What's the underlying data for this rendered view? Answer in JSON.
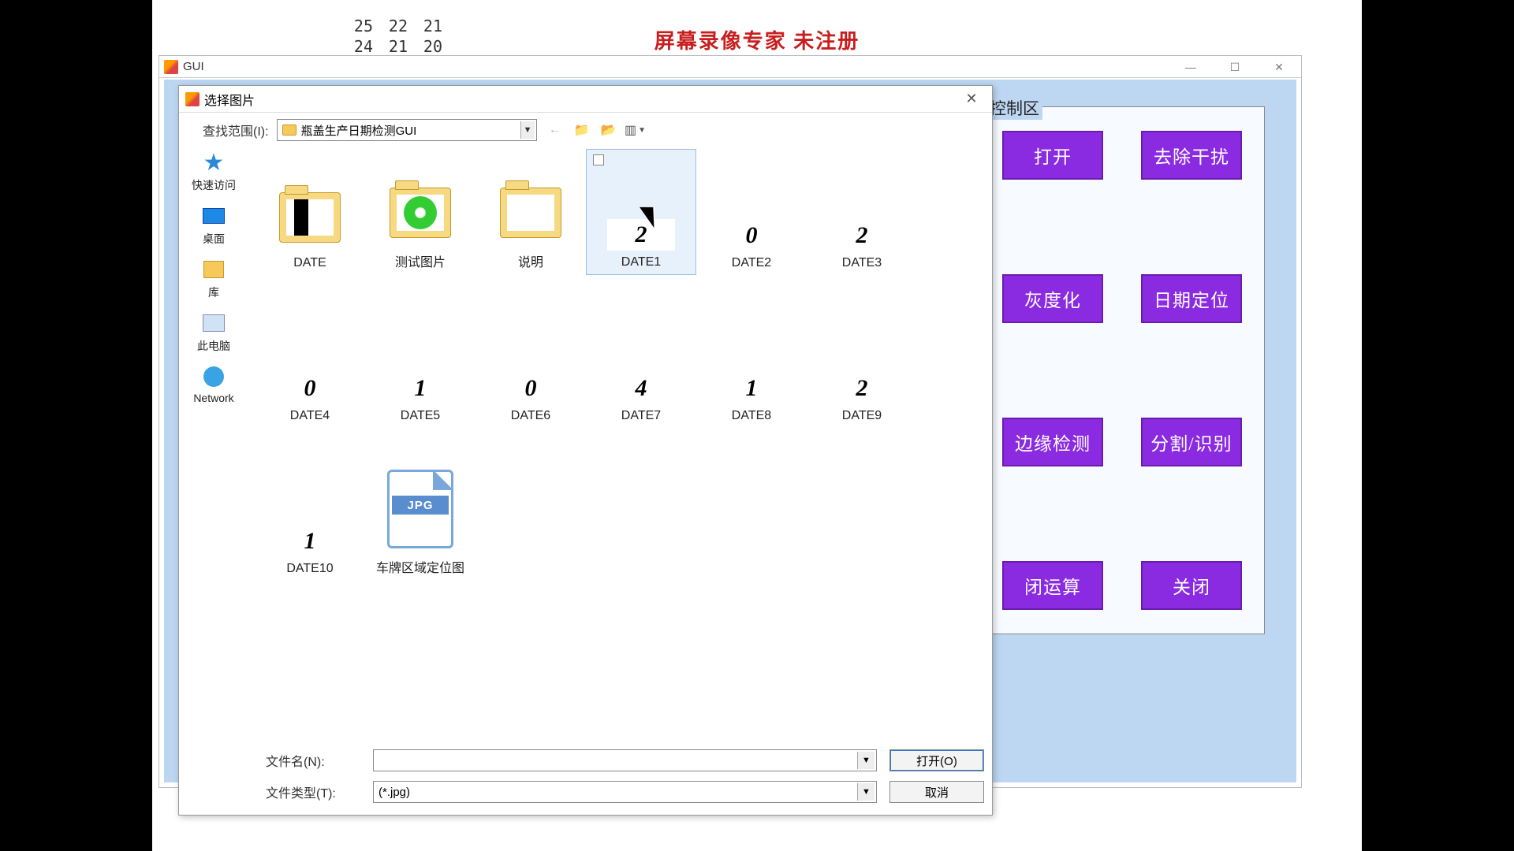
{
  "watermark": "屏幕录像专家 未注册",
  "bg_rows": [
    [
      "25",
      "22",
      "21"
    ],
    [
      "24",
      "21",
      "20"
    ]
  ],
  "gui": {
    "title": "GUI",
    "win_min": "—",
    "win_max": "☐",
    "win_close": "✕",
    "control_legend": "控制区",
    "buttons": [
      "打开",
      "去除干扰",
      "灰度化",
      "日期定位",
      "边缘检测",
      "分割/识别",
      "闭运算",
      "关闭"
    ]
  },
  "dialog": {
    "title": "选择图片",
    "lookin_label": "查找范围(I):",
    "lookin_value": "瓶盖生产日期检测GUI",
    "toolbar": {
      "back": "←",
      "up": "folder",
      "new": "folder*",
      "views": "▥ ▾"
    },
    "places": [
      {
        "id": "quick",
        "label": "快速访问"
      },
      {
        "id": "desktop",
        "label": "桌面"
      },
      {
        "id": "lib",
        "label": "库"
      },
      {
        "id": "pc",
        "label": "此电脑"
      },
      {
        "id": "net",
        "label": "Network"
      }
    ],
    "items": [
      {
        "kind": "folder",
        "label": "DATE",
        "glyph": "1",
        "inner": "bw"
      },
      {
        "kind": "folder",
        "label": "测试图片",
        "glyph": "disc"
      },
      {
        "kind": "folder",
        "label": "说明",
        "glyph": ""
      },
      {
        "kind": "image",
        "label": "DATE1",
        "glyph": "2",
        "selected": true
      },
      {
        "kind": "image",
        "label": "DATE2",
        "glyph": "0"
      },
      {
        "kind": "image",
        "label": "DATE3",
        "glyph": "2"
      },
      {
        "kind": "image",
        "label": "DATE4",
        "glyph": "0"
      },
      {
        "kind": "image",
        "label": "DATE5",
        "glyph": "1"
      },
      {
        "kind": "image",
        "label": "DATE6",
        "glyph": "0"
      },
      {
        "kind": "image",
        "label": "DATE7",
        "glyph": "4"
      },
      {
        "kind": "image",
        "label": "DATE8",
        "glyph": "1"
      },
      {
        "kind": "image",
        "label": "DATE9",
        "glyph": "2"
      },
      {
        "kind": "image",
        "label": "DATE10",
        "glyph": "1"
      },
      {
        "kind": "jpg",
        "label": "车牌区域定位图"
      }
    ],
    "filename_label": "文件名(N):",
    "filename_value": "",
    "filetype_label": "文件类型(T):",
    "filetype_value": "(*.jpg)",
    "open_btn": "打开(O)",
    "cancel_btn": "取消"
  }
}
